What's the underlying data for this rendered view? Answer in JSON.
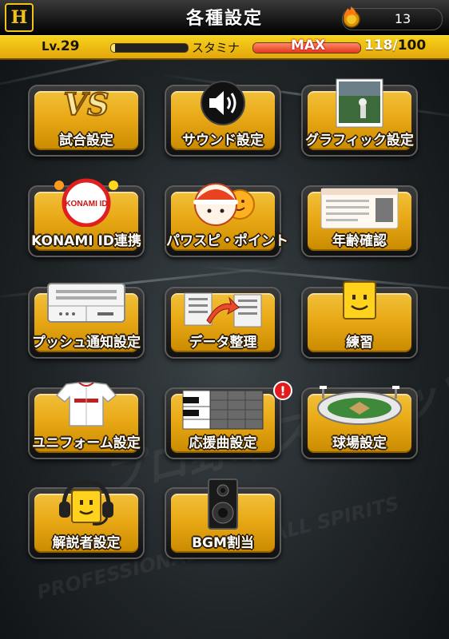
{
  "header": {
    "logo_text": "H",
    "title": "各種設定",
    "currency_count": "13"
  },
  "status": {
    "level_prefix": "Lv.",
    "level": "29",
    "exp_fraction": 0.05,
    "stamina_label": "スタミナ",
    "stamina_max_tag": "MAX",
    "stamina_fraction": 1.0,
    "stamina_current": "118",
    "stamina_separator": "/",
    "stamina_max": "100"
  },
  "background": {
    "watermark_1": "プロ野球スピリッツA",
    "watermark_2": "PROFESSIONAL BASEBALL SPIRITS"
  },
  "menu": [
    {
      "label": "試合設定",
      "icon": "vs-icon",
      "icon_text": "VS"
    },
    {
      "label": "サウンド設定",
      "icon": "speaker-icon"
    },
    {
      "label": "グラフィック設定",
      "icon": "photo-icon"
    },
    {
      "label": "KONAMI ID連携",
      "icon": "konami-id-icon",
      "icon_text": "KONAMI ID"
    },
    {
      "label": "パワスピ・ポイント",
      "icon": "pawapuro-mascot-icon"
    },
    {
      "label": "年齢確認",
      "icon": "id-card-icon"
    },
    {
      "label": "プッシュ通知設定",
      "icon": "notification-panel-icon"
    },
    {
      "label": "データ整理",
      "icon": "data-transfer-icon"
    },
    {
      "label": "練習",
      "icon": "smiley-block-icon"
    },
    {
      "label": "ユニフォーム設定",
      "icon": "uniform-icon"
    },
    {
      "label": "応援曲設定",
      "icon": "piano-keys-icon",
      "badge": "!"
    },
    {
      "label": "球場設定",
      "icon": "stadium-icon"
    },
    {
      "label": "解説者設定",
      "icon": "headset-icon"
    },
    {
      "label": "BGM割当",
      "icon": "loudspeaker-icon"
    }
  ],
  "colors": {
    "accent_gold": "#e9a916",
    "status_yellow": "#f6d21c",
    "badge_red": "#e41b1b"
  }
}
